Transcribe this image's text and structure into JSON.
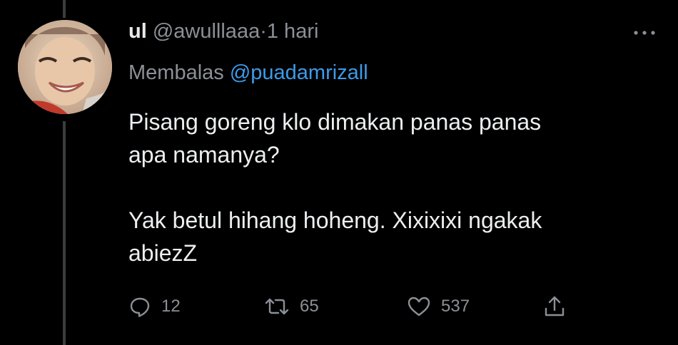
{
  "tweet": {
    "display_name": "ul",
    "handle": "@awulllaaa",
    "separator": "·",
    "time": "1 hari",
    "reply_prefix": "Membalas",
    "reply_to": "@puadamrizall",
    "text_line1": "Pisang goreng klo dimakan panas panas",
    "text_line2": "apa namanya?",
    "text_line3": "Yak betul hihang hoheng. Xixixixi ngakak",
    "text_line4": "abiezZ"
  },
  "actions": {
    "reply_count": "12",
    "retweet_count": "65",
    "like_count": "537"
  },
  "icons": {
    "more": "more-horizontal-icon",
    "reply": "comment-icon",
    "retweet": "retweet-icon",
    "like": "heart-icon",
    "share": "share-icon"
  },
  "colors": {
    "background": "#000000",
    "text": "#e7e9ea",
    "muted": "#8b9096",
    "mention": "#3d9be9"
  }
}
